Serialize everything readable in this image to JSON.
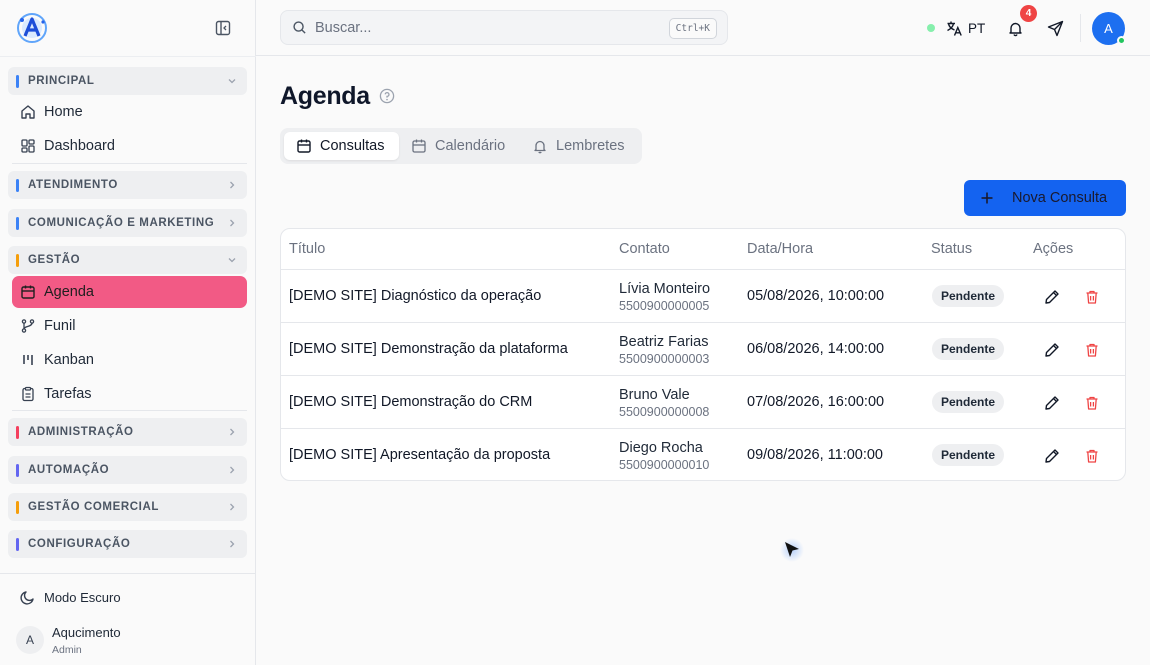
{
  "sidebar": {
    "sections": [
      {
        "label": "PRINCIPAL",
        "color": "#3b82f6"
      },
      {
        "label": "ATENDIMENTO",
        "color": "#3b82f6"
      },
      {
        "label": "COMUNICAÇÃO E MARKETING",
        "color": "#3b82f6"
      },
      {
        "label": "GESTÃO",
        "color": "#f59e0b"
      },
      {
        "label": "ADMINISTRAÇÃO",
        "color": "#f43f5e"
      },
      {
        "label": "AUTOMAÇÃO",
        "color": "#6366f1"
      },
      {
        "label": "GESTÃO COMERCIAL",
        "color": "#f59e0b"
      },
      {
        "label": "CONFIGURAÇÃO",
        "color": "#6366f1"
      }
    ],
    "items": {
      "home": "Home",
      "dashboard": "Dashboard",
      "agenda": "Agenda",
      "funil": "Funil",
      "kanban": "Kanban",
      "tarefas": "Tarefas"
    },
    "dark_mode": "Modo Escuro",
    "user": {
      "initial": "A",
      "name": "Aqucimento",
      "role": "Admin"
    }
  },
  "topbar": {
    "search_placeholder": "Buscar...",
    "shortcut": "Ctrl+K",
    "language": "PT",
    "notifications": "4",
    "avatar_initial": "A"
  },
  "main": {
    "title": "Agenda",
    "tabs": [
      "Consultas",
      "Calendário",
      "Lembretes"
    ],
    "new_button": "Nova Consulta",
    "columns": [
      "Título",
      "Contato",
      "Data/Hora",
      "Status",
      "Ações"
    ],
    "rows": [
      {
        "title": "[DEMO SITE] Diagnóstico da operação",
        "contact": "Lívia Monteiro",
        "phone": "5500900000005",
        "datetime": "05/08/2026, 10:00:00",
        "status": "Pendente"
      },
      {
        "title": "[DEMO SITE] Demonstração da plataforma",
        "contact": "Beatriz Farias",
        "phone": "5500900000003",
        "datetime": "06/08/2026, 14:00:00",
        "status": "Pendente"
      },
      {
        "title": "[DEMO SITE] Demonstração do CRM",
        "contact": "Bruno Vale",
        "phone": "5500900000008",
        "datetime": "07/08/2026, 16:00:00",
        "status": "Pendente"
      },
      {
        "title": "[DEMO SITE] Apresentação da proposta",
        "contact": "Diego Rocha",
        "phone": "5500900000010",
        "datetime": "09/08/2026, 11:00:00",
        "status": "Pendente"
      }
    ]
  },
  "colors": {
    "accent": "#1463f0",
    "active_nav": "#f25a85",
    "danger": "#ef4444"
  }
}
